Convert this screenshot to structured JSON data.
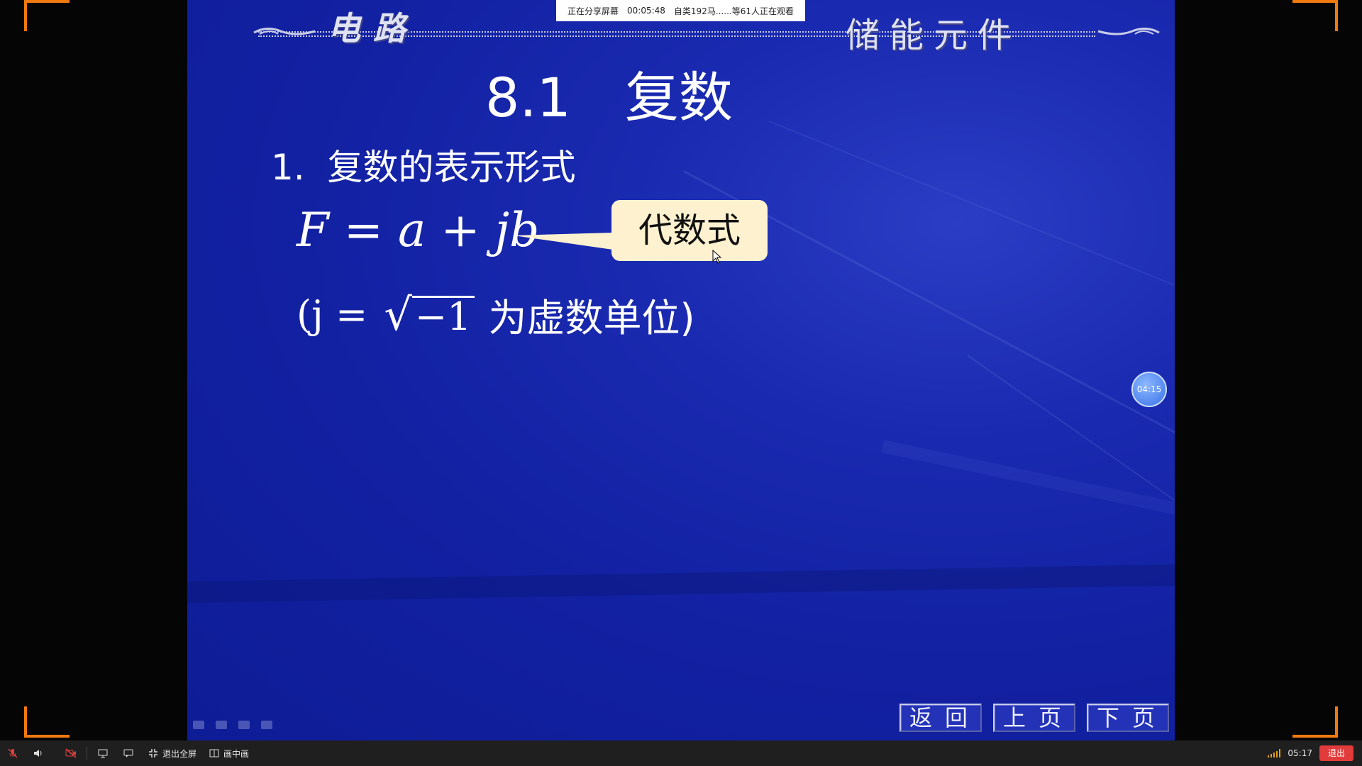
{
  "share_banner": {
    "status": "正在分享屏幕",
    "elapsed": "00:05:48",
    "viewers": "自类192马......等61人正在观看"
  },
  "slide": {
    "header_left": "电路",
    "header_right": "储能元件",
    "title": "8.1　复数",
    "subtitle": "1.  复数的表示形式",
    "formula": "F = a + jb",
    "callout": "代数式",
    "imag_open": "(j = ",
    "imag_radicand": "−1",
    "imag_text": "为虚数单位)",
    "nav": {
      "back": "返回",
      "prev": "上页",
      "next": "下页"
    }
  },
  "timer_bubble": "04:15",
  "taskbar": {
    "exit_fullscreen": "退出全屏",
    "picture_in_picture": "画中画",
    "clock": "05:17",
    "exit": "退出",
    "icons": [
      "mic-muted-icon",
      "speaker-icon",
      "camera-off-icon",
      "screen-share-icon",
      "chat-icon",
      "fullscreen-exit-icon",
      "pip-icon",
      "signal-icon"
    ]
  },
  "colors": {
    "accent_orange": "#f07a10",
    "slide_blue": "#1526a6",
    "callout_bg": "#fdf1cf",
    "exit_red": "#e23b3b"
  }
}
